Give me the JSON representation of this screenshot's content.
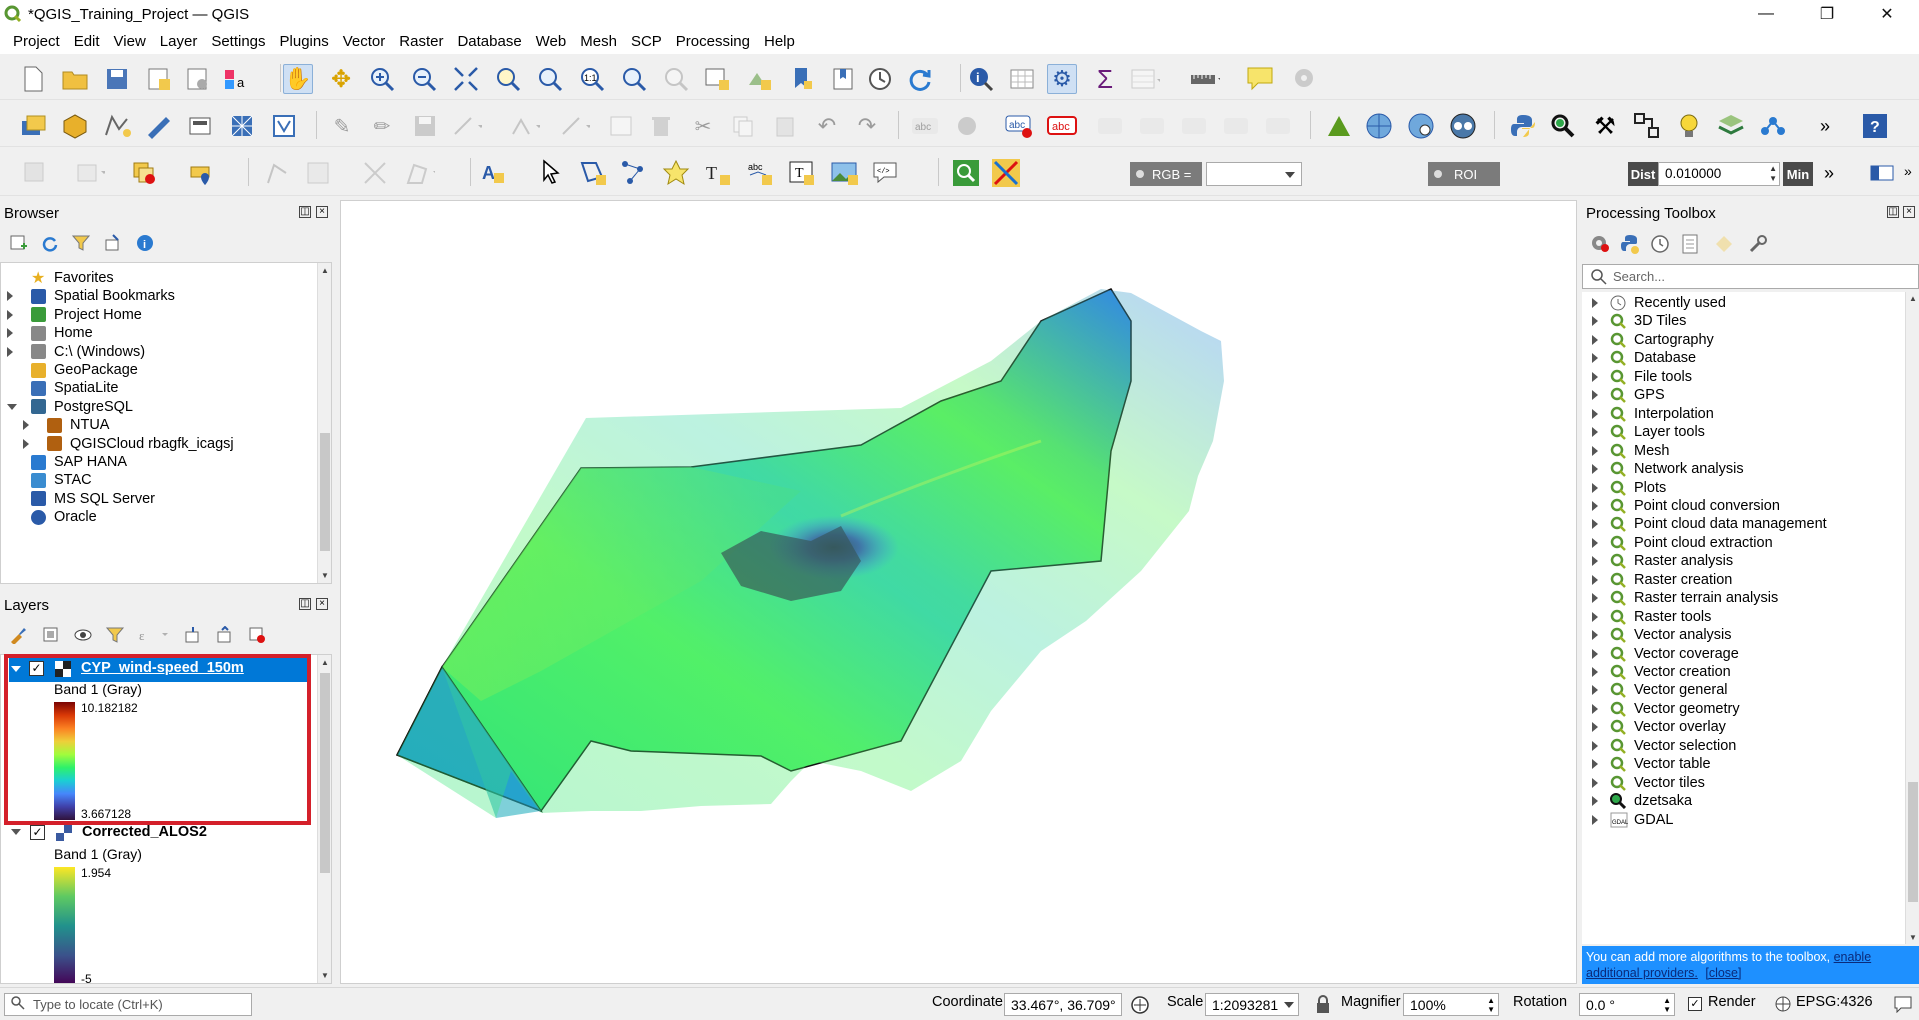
{
  "window": {
    "title": "*QGIS_Training_Project — QGIS",
    "minimize": "—",
    "restore": "❐",
    "close": "✕"
  },
  "menu": [
    "Project",
    "Edit",
    "View",
    "Layer",
    "Settings",
    "Plugins",
    "Vector",
    "Raster",
    "Database",
    "Web",
    "Mesh",
    "SCP",
    "Processing",
    "Help"
  ],
  "scp_toolbar": {
    "rgb_label": "RGB =",
    "rgb_value": "",
    "roi_label": "ROI",
    "dist_label": "Dist",
    "dist_value": "0.010000",
    "min_label": "Min"
  },
  "browser": {
    "title": "Browser",
    "items": [
      {
        "label": "Favorites",
        "icon": "star-icon",
        "expand": "none"
      },
      {
        "label": "Spatial Bookmarks",
        "icon": "bookmark-icon",
        "expand": "collapsed"
      },
      {
        "label": "Project Home",
        "icon": "project-folder-icon",
        "expand": "collapsed"
      },
      {
        "label": "Home",
        "icon": "home-folder-icon",
        "expand": "collapsed"
      },
      {
        "label": "C:\\ (Windows)",
        "icon": "drive-folder-icon",
        "expand": "collapsed"
      },
      {
        "label": "GeoPackage",
        "icon": "geopackage-icon",
        "expand": "none"
      },
      {
        "label": "SpatiaLite",
        "icon": "spatialite-icon",
        "expand": "none"
      },
      {
        "label": "PostgreSQL",
        "icon": "postgresql-icon",
        "expand": "expanded"
      },
      {
        "label": "NTUA",
        "icon": "connection-icon",
        "expand": "collapsed",
        "indent": 1
      },
      {
        "label": "QGISCloud rbagfk_icagsj",
        "icon": "connection-icon",
        "expand": "collapsed",
        "indent": 1
      },
      {
        "label": "SAP HANA",
        "icon": "sap-hana-icon",
        "expand": "none"
      },
      {
        "label": "STAC",
        "icon": "stac-icon",
        "expand": "none"
      },
      {
        "label": "MS SQL Server",
        "icon": "mssql-icon",
        "expand": "none"
      },
      {
        "label": "Oracle",
        "icon": "oracle-icon",
        "expand": "none"
      }
    ]
  },
  "layers": {
    "title": "Layers",
    "items": [
      {
        "name": "CYP_wind-speed_150m",
        "band": "Band 1 (Gray)",
        "max": "10.182182",
        "min": "3.667128",
        "selected": true,
        "colors": [
          "#7a0403",
          "#d93806",
          "#fb8022",
          "#eecf3a",
          "#a2fc3c",
          "#2ef16a",
          "#1bcfd4",
          "#4686fb",
          "#4040a8",
          "#30123b"
        ]
      },
      {
        "name": "Corrected_ALOS2",
        "band": "Band 1 (Gray)",
        "max": "1.954",
        "min": "-5",
        "selected": false,
        "colors": [
          "#fde725",
          "#5ec962",
          "#21918c",
          "#3b528b",
          "#440154"
        ]
      }
    ]
  },
  "processing": {
    "title": "Processing Toolbox",
    "search_placeholder": "Search...",
    "items": [
      {
        "label": "Recently used",
        "icon": "clock-icon"
      },
      {
        "label": "3D Tiles",
        "icon": "q-icon"
      },
      {
        "label": "Cartography",
        "icon": "q-icon"
      },
      {
        "label": "Database",
        "icon": "q-icon"
      },
      {
        "label": "File tools",
        "icon": "q-icon"
      },
      {
        "label": "GPS",
        "icon": "q-icon"
      },
      {
        "label": "Interpolation",
        "icon": "q-icon"
      },
      {
        "label": "Layer tools",
        "icon": "q-icon"
      },
      {
        "label": "Mesh",
        "icon": "q-icon"
      },
      {
        "label": "Network analysis",
        "icon": "q-icon"
      },
      {
        "label": "Plots",
        "icon": "q-icon"
      },
      {
        "label": "Point cloud conversion",
        "icon": "q-icon"
      },
      {
        "label": "Point cloud data management",
        "icon": "q-icon"
      },
      {
        "label": "Point cloud extraction",
        "icon": "q-icon"
      },
      {
        "label": "Raster analysis",
        "icon": "q-icon"
      },
      {
        "label": "Raster creation",
        "icon": "q-icon"
      },
      {
        "label": "Raster terrain analysis",
        "icon": "q-icon"
      },
      {
        "label": "Raster tools",
        "icon": "q-icon"
      },
      {
        "label": "Vector analysis",
        "icon": "q-icon"
      },
      {
        "label": "Vector coverage",
        "icon": "q-icon"
      },
      {
        "label": "Vector creation",
        "icon": "q-icon"
      },
      {
        "label": "Vector general",
        "icon": "q-icon"
      },
      {
        "label": "Vector geometry",
        "icon": "q-icon"
      },
      {
        "label": "Vector overlay",
        "icon": "q-icon"
      },
      {
        "label": "Vector selection",
        "icon": "q-icon"
      },
      {
        "label": "Vector table",
        "icon": "q-icon"
      },
      {
        "label": "Vector tiles",
        "icon": "q-icon"
      },
      {
        "label": "dzetsaka",
        "icon": "magnifier-icon"
      },
      {
        "label": "GDAL",
        "icon": "gdal-icon"
      }
    ],
    "notice_text": "You can add more algorithms to the toolbox, ",
    "notice_link": "enable additional providers.",
    "notice_close": "[close]"
  },
  "status": {
    "locate_placeholder": "Type to locate (Ctrl+K)",
    "coordinate_label": "Coordinate",
    "coordinate_value": "33.467°, 36.709°",
    "scale_label": "Scale",
    "scale_value": "1:2093281",
    "magnifier_label": "Magnifier",
    "magnifier_value": "100%",
    "rotation_label": "Rotation",
    "rotation_value": "0.0 °",
    "render_label": "Render",
    "crs": "EPSG:4326"
  },
  "accent": "#0078d7",
  "highlight_box": "#d4202a"
}
